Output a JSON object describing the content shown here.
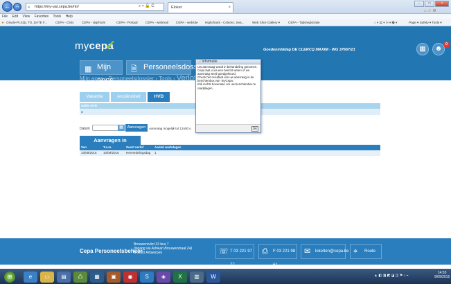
{
  "browser": {
    "address": "https://my-uat.cepa.be/ntr/",
    "address_tools": "⌕ ▾ 🔒 C",
    "tab_title": "Eloket",
    "tab_close": "×",
    "back_symbol": "←",
    "forward_symbol": "→",
    "menu": [
      "File",
      "Edit",
      "View",
      "Favorites",
      "Tools",
      "Help"
    ],
    "favorites": [
      "Oracle-PLSQL TO_DATE F...",
      "CEPA - Citrix",
      "CEPA - digiTools",
      "CEPA - Portaal",
      "CEPA - webmail",
      "CEPA - website",
      "Highcharts - Column, Sea...",
      "Web Slice Gallery ▾",
      "CEPA - Tijdsregistratie"
    ],
    "command_bar": "Page ▾  Safety ▾  Tools ▾",
    "window_controls": {
      "minimize": "–",
      "maximize": "□",
      "close": "×"
    }
  },
  "header": {
    "logo_my": "my",
    "logo_cepa": "cepa",
    "logo_check": "✓",
    "btn_apps": "Mijn apps",
    "btn_personeel": "Personeelsdossier",
    "greeting": "Goedenmiddag DE CLERCQ MAXIM - WG 37667/21",
    "notification_count": "0"
  },
  "breadcrumb": {
    "path": "Mijn apps › Personeelsdossier › Tools › ",
    "current": "Verlof aan"
  },
  "tabs": [
    "Vakantie",
    "Anciënniteit",
    "HVD"
  ],
  "saldo": {
    "header": "Saldo HVD",
    "value": "3"
  },
  "request": {
    "datum_label": "Datum",
    "button": "Aanvragen",
    "hint": "Aanvraag mogelijk tot 12u00 o"
  },
  "section": {
    "title": "Aanvragen in behandeling"
  },
  "table": {
    "columns": [
      "Van",
      "T.e.m.",
      "Soort verlof",
      "Aantal werkdagen"
    ],
    "rows": [
      [
        "10/09/2015",
        "10/09/2015",
        "Herverdelingsdag",
        "1"
      ]
    ]
  },
  "popup": {
    "title": "Informatie",
    "lines": [
      "Uw aanvraag wordt in behandeling genomen.",
      "Cepa laat u via een bericht weten of uw aanvraag werd goedgekeurd.",
      "Check het resultaat van uw aanvraag in de berichtenbox van 'myCepa'.",
      "Klik rechts bovenaan om uw berichtenbox te raadplegen."
    ],
    "ok": "OK"
  },
  "footer": {
    "title": "Cepa Personeelsbeheer",
    "address": [
      "Brouwersvliet 33 bus 7",
      "(ingang via Adriaan Brouwerstraat 24)",
      "B-2000 Antwerpen"
    ],
    "tel": "T 03 221 97 77",
    "fax": "F 03 221 98 61",
    "email": "loketten@cepa.be",
    "route": "Route"
  },
  "taskbar": {
    "time": "14:55",
    "date": "9/09/2015"
  },
  "colors": {
    "brand": "#2277b3",
    "accent": "#8cc63f",
    "light": "#9dd0ee"
  }
}
